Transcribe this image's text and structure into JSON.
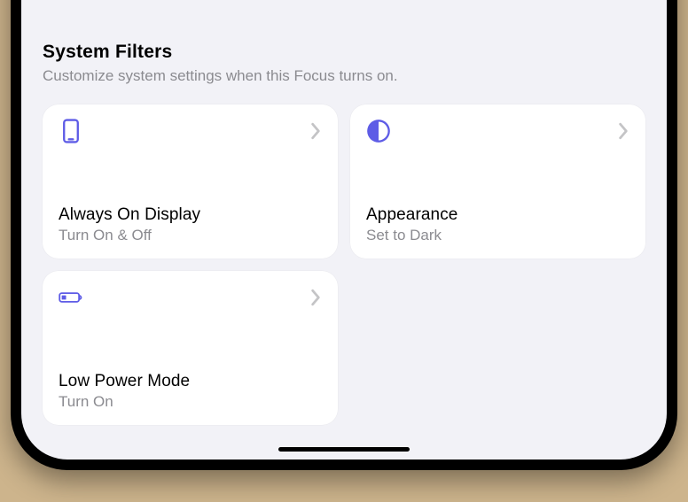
{
  "section": {
    "title": "System Filters",
    "subtitle": "Customize system settings when this Focus turns on."
  },
  "tiles": [
    {
      "title": "Always On Display",
      "subtitle": "Turn On & Off"
    },
    {
      "title": "Appearance",
      "subtitle": "Set to Dark"
    },
    {
      "title": "Low Power Mode",
      "subtitle": "Turn On"
    }
  ]
}
